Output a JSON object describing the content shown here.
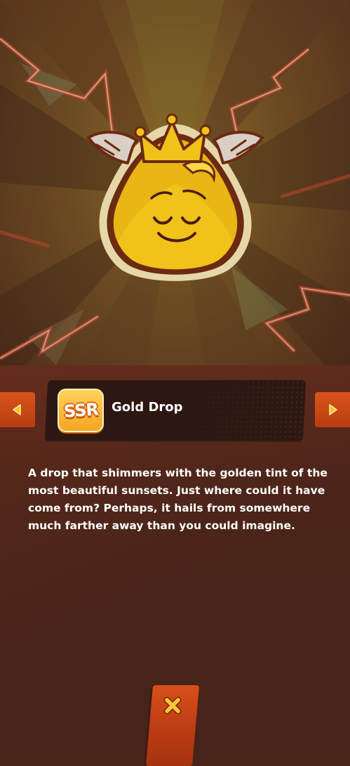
{
  "item": {
    "rarity": "SSR",
    "name": "Gold Drop",
    "description": "A drop that shimmers with the golden tint of the most beautiful sunsets. Just where could it have come from? Perhaps, it hails from somewhere much farther away than you could imagine."
  },
  "icons": {
    "prev": "chevron-left-icon",
    "next": "chevron-right-icon",
    "close": "close-icon",
    "character": "gold-drop-icon"
  },
  "colors": {
    "background": "#4a2419",
    "accent": "#d9541a",
    "gold": "#f0c21a",
    "rarity_badge": "#f5a524"
  }
}
